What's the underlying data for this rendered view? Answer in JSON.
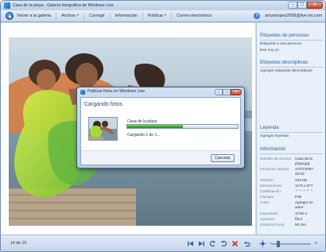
{
  "window": {
    "title": "Casa de la playa - Galería fotográfica de Windows Live",
    "controls": {
      "minimize": "‒",
      "maximize": "□",
      "close": "✕"
    }
  },
  "toolbar": {
    "back_icon": "back-arrow-icon",
    "items": [
      {
        "label": "Volver a la galería",
        "dropdown": false
      },
      {
        "label": "Archivo",
        "dropdown": true
      },
      {
        "label": "Corregir",
        "dropdown": false
      },
      {
        "label": "Información",
        "dropdown": false
      },
      {
        "label": "Publicar",
        "dropdown": true
      },
      {
        "label": "Correo electrónico",
        "dropdown": false
      }
    ],
    "help": "?",
    "account": "arturolopez2008@live-int.com"
  },
  "pane": {
    "people_heading": "Etiquetas de personas",
    "people_add": "Etiquetar a una persona",
    "people_me": "Ese soy yo",
    "desc_heading": "Etiquetas descriptivas",
    "desc_add": "Agregar etiquetas descriptivas",
    "caption_heading": "Leyenda",
    "caption_add": "Agregar leyenda",
    "info_heading": "Información",
    "info": [
      {
        "label": "Nombre de archivo:",
        "value": "Casa de la"
      },
      {
        "label": "",
        "value": "playa.jpg"
      },
      {
        "label": "Fecha de captura:",
        "value": "17/07/2007"
      },
      {
        "label": "",
        "value": "22:00"
      },
      {
        "label": "Tamaño:",
        "value": "243 KB"
      },
      {
        "label": "Dimensiones:",
        "value": "1176 x 877"
      },
      {
        "label": "Clasificación:",
        "value": ""
      },
      {
        "label": "Cámara:",
        "value": "P30"
      },
      {
        "label": "Autor:",
        "value": "Agregar un"
      },
      {
        "label": "",
        "value": "autor"
      },
      {
        "label": "Exposición:",
        "value": "1/750 s"
      },
      {
        "label": "Apertura:",
        "value": "f/8.0"
      },
      {
        "label": "Distancia focal:",
        "value": "50 mm"
      }
    ],
    "rating": "★★★★★",
    "rating_value": 0,
    "rating_max": 5
  },
  "bottom": {
    "counter": "14 de 19"
  },
  "dialog": {
    "title": "Publicar fotos en Windows Live",
    "heading": "Cargando fotos",
    "file": "Casa de la playa",
    "status": "Cargando 1 de 1...",
    "progress": 0.5,
    "cancel": "Cancelar"
  },
  "colors": {
    "accent": "#2b5f9e",
    "progress": "#2fae18"
  }
}
